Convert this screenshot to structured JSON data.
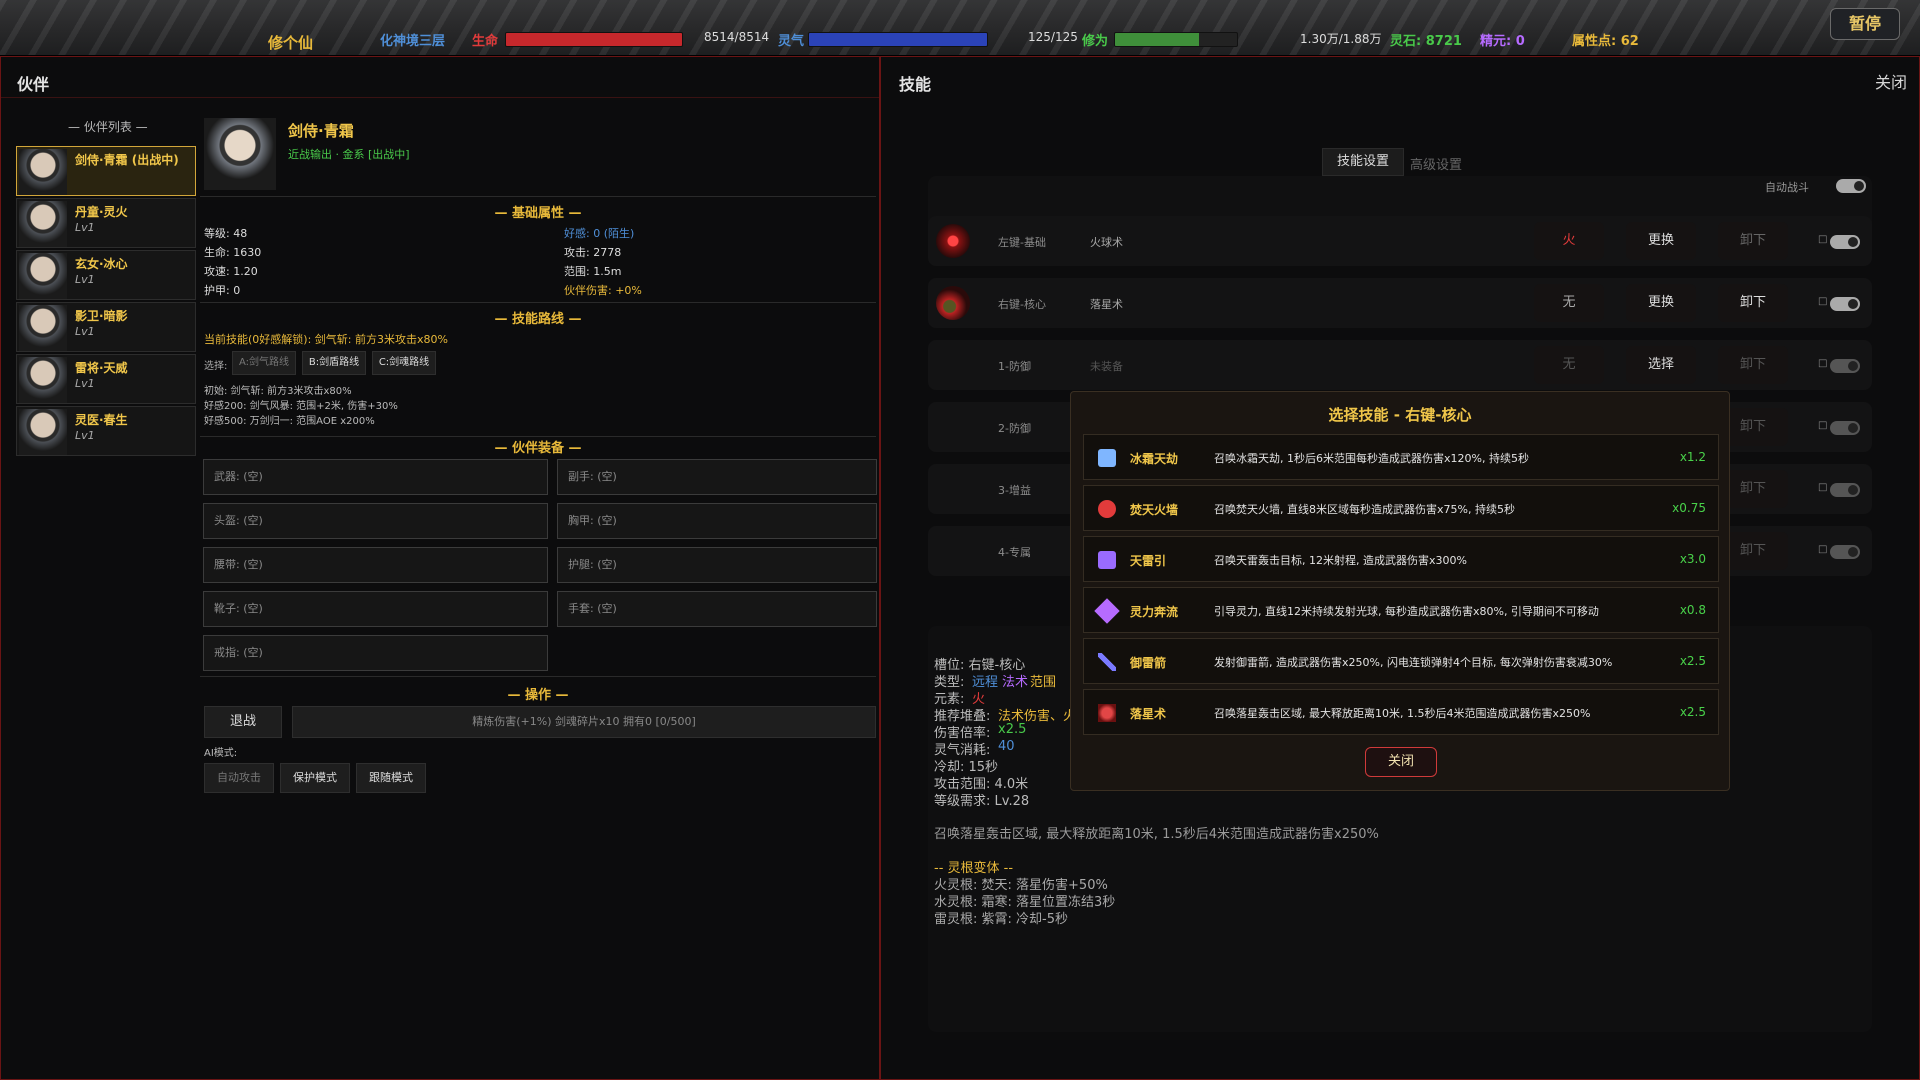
{
  "topbar": {
    "game_title": "修个仙",
    "realm": "化神境三层",
    "hp_label": "生命",
    "hp_value": "8514/8514",
    "hp_fraction": 1.0,
    "mp_label": "灵气",
    "mp_value": "125/125",
    "mp_fraction": 1.0,
    "cultivation_label": "修为",
    "cultivation_value": "1.30万/1.88万",
    "cultivation_fraction": 0.69,
    "spirit_stones": "灵石: 8721",
    "essence": "精元: 0",
    "attr_points": "属性点: 62",
    "pause_label": "暂停",
    "colors": {
      "hp": "#c6282c",
      "mp": "#2b43b8",
      "cult": "#3f8f3a"
    }
  },
  "partner": {
    "panel_title": "伙伴",
    "list_title": "— 伙伴列表 —",
    "list": [
      {
        "name": "剑侍·青霜 (出战中)",
        "level": "",
        "active": true
      },
      {
        "name": "丹童·灵火",
        "level": "Lv1"
      },
      {
        "name": "玄女·冰心",
        "level": "Lv1"
      },
      {
        "name": "影卫·暗影",
        "level": "Lv1"
      },
      {
        "name": "雷将·天威",
        "level": "Lv1"
      },
      {
        "name": "灵医·春生",
        "level": "Lv1"
      }
    ],
    "selected_name": "剑侍·青霜",
    "selected_sub": "近战输出 · 金系 [出战中]",
    "basic_header": "— 基础属性 —",
    "stats_left": [
      "等级: 48",
      "生命: 1630",
      "攻速: 1.20",
      "护甲: 0"
    ],
    "stats_right": [
      "好感: 0 (陌生)",
      "攻击: 2778",
      "范围: 1.5m",
      "伙伴伤害: +0%"
    ],
    "route_header": "— 技能路线 —",
    "current_skill": "当前技能(0好感解锁): 剑气斩: 前方3米攻击x80%",
    "route_select_label": "选择:",
    "routes": [
      "A:剑气路线",
      "B:剑盾路线",
      "C:剑魂路线"
    ],
    "route_notes": [
      "初始: 剑气斩: 前方3米攻击x80%",
      "好感200: 剑气风暴: 范围+2米, 伤害+30%",
      "好感500: 万剑归一: 范围AOE x200%"
    ],
    "equip_header": "— 伙伴装备 —",
    "equip": [
      "武器: (空)",
      "副手: (空)",
      "头盔: (空)",
      "胸甲: (空)",
      "腰带: (空)",
      "护腿: (空)",
      "靴子: (空)",
      "手套: (空)",
      "戒指: (空)"
    ],
    "ops_header": "— 操作 —",
    "retreat_label": "退战",
    "refine_label": "精炼伤害(+1%) 剑魂碎片x10 拥有0 [0/500]",
    "ai_label": "AI模式:",
    "ai_modes": [
      "自动攻击",
      "保护模式",
      "跟随模式"
    ]
  },
  "skills": {
    "panel_title": "技能",
    "close_label": "关闭",
    "tabs": [
      "技能设置",
      "高级设置"
    ],
    "auto_battle": "自动战斗",
    "rows": [
      {
        "slot": "左键-基础",
        "skill": "火球术",
        "element": "火",
        "change": "更换",
        "unequip": "卸下",
        "enabled": true
      },
      {
        "slot": "右键-核心",
        "skill": "落星术",
        "element": "无",
        "change": "更换",
        "unequip": "卸下",
        "enabled": true
      },
      {
        "slot": "1-防御",
        "skill": "未装备",
        "element": "无",
        "change": "选择",
        "unequip": "卸下",
        "enabled": false
      },
      {
        "slot": "2-防御",
        "skill": "",
        "element": "",
        "change": "",
        "unequip": "卸下",
        "enabled": false
      },
      {
        "slot": "3-增益",
        "skill": "",
        "element": "",
        "change": "",
        "unequip": "卸下",
        "enabled": false
      },
      {
        "slot": "4-专属",
        "skill": "",
        "element": "",
        "change": "",
        "unequip": "卸下",
        "enabled": false
      }
    ],
    "detail": {
      "slot": "槽位: 右键-核心",
      "type_label": "类型:",
      "types": [
        "远程",
        "法术",
        "范围"
      ],
      "element_label": "元素:",
      "element": "火",
      "recommend_label": "推荐堆叠:",
      "recommend": "法术伤害、火",
      "dmg_label": "伤害倍率:",
      "dmg": "x2.5",
      "mana_label": "灵气消耗:",
      "mana": "40",
      "cd": "冷却: 15秒",
      "range": "攻击范围: 4.0米",
      "req": "等级需求: Lv.28",
      "desc": "召唤落星轰击区域, 最大释放距离10米, 1.5秒后4米范围造成武器伤害x250%",
      "variant_header": "-- 灵根变体 --",
      "variants": [
        "火灵根: 焚天: 落星伤害+50%",
        "水灵根: 霜寒: 落星位置冻结3秒",
        "雷灵根: 紫霄: 冷却-5秒"
      ]
    }
  },
  "modal": {
    "title": "选择技能 - 右键-核心",
    "items": [
      {
        "name": "冰霜天劫",
        "desc": "召唤冰霜天劫, 1秒后6米范围每秒造成武器伤害x120%, 持续5秒",
        "mult": "x1.2",
        "icon": "ice-storm-icon",
        "color": "#7fb6ff"
      },
      {
        "name": "焚天火墙",
        "desc": "召唤焚天火墙, 直线8米区域每秒造成武器伤害x75%, 持续5秒",
        "mult": "x0.75",
        "icon": "fire-wall-icon",
        "color": "#e23b3b"
      },
      {
        "name": "天雷引",
        "desc": "召唤天雷轰击目标, 12米射程, 造成武器伤害x300%",
        "mult": "x3.0",
        "icon": "thunder-icon",
        "color": "#9a6bff"
      },
      {
        "name": "灵力奔流",
        "desc": "引导灵力, 直线12米持续发射光球, 每秒造成武器伤害x80%, 引导期间不可移动",
        "mult": "x0.8",
        "icon": "spirit-flow-icon",
        "color": "#b66bff"
      },
      {
        "name": "御雷箭",
        "desc": "发射御雷箭, 造成武器伤害x250%, 闪电连锁弹射4个目标, 每次弹射伤害衰减30%",
        "mult": "x2.5",
        "icon": "thunder-arrow-icon",
        "color": "#7a7aff"
      },
      {
        "name": "落星术",
        "desc": "召唤落星轰击区域, 最大释放距离10米, 1.5秒后4米范围造成武器伤害x250%",
        "mult": "x2.5",
        "icon": "meteor-icon",
        "color": "#e24646"
      }
    ],
    "close_label": "关闭"
  }
}
